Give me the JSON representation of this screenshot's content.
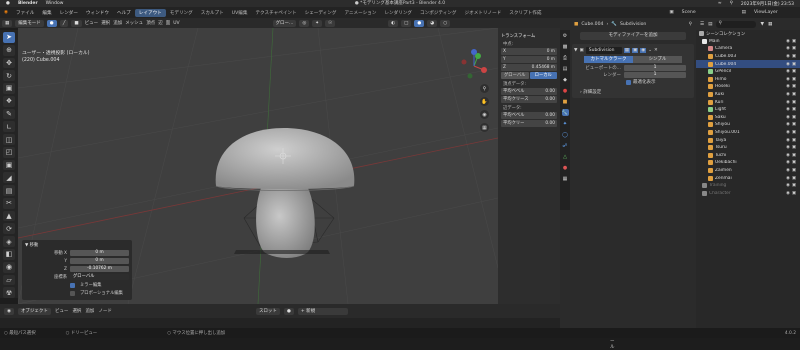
{
  "mac": {
    "app": "Blender",
    "menu": "Window",
    "date": "2023年9月1日(金) 23:53",
    "apple": ""
  },
  "window_title": "● *モデリング基本講座Part3 - Blender 4.0",
  "menubar": {
    "items": [
      "ファイル",
      "編集",
      "レンダー",
      "ウィンドウ",
      "ヘルプ"
    ],
    "workspaces": [
      "レイアウト",
      "モデリング",
      "スカルプト",
      "UV編集",
      "テクスチャペイント",
      "シェーディング",
      "アニメーション",
      "レンダリング",
      "コンポジティング",
      "ジオメトリノード",
      "スクリプト作成"
    ],
    "scene": "Scene",
    "viewlayer": "ViewLayer"
  },
  "viewport_header": {
    "mode": "編集モード",
    "menus": [
      "ビュー",
      "選択",
      "追加",
      "メッシュ",
      "頂点",
      "辺",
      "面",
      "UV"
    ],
    "orientation": "グロー...",
    "options": "オプション"
  },
  "viewport_info": {
    "line1": "ユーザー・透視投影 (ローカル)",
    "line2": "(220) Cube.004"
  },
  "transform": {
    "title": "トランスフォーム",
    "median": "中点:",
    "x": {
      "label": "X",
      "value": "0 m"
    },
    "y": {
      "label": "Y",
      "value": "0 m"
    },
    "z": {
      "label": "Z",
      "value": "0.45468 m"
    },
    "global": "グローバル",
    "local": "ローカル",
    "vertex_data": "頂点データ:",
    "v_bevel": "平均ベベル",
    "v_bevel_val": "0.00",
    "v_crease": "平均クリース",
    "v_crease_val": "0.00",
    "edge_data": "辺データ:",
    "e_bevel": "平均ベベル",
    "e_bevel_val": "0.00",
    "e_crease": "平均クリー",
    "e_crease_val": "0.00"
  },
  "op_panel": {
    "title": "移動",
    "move_x_label": "移動 X",
    "move_x": "0 m",
    "y_label": "Y",
    "y": "0 m",
    "z_label": "Z",
    "z": "-0.10762 m",
    "orient_label": "座標系",
    "orient": "グローバル",
    "mirror": "ミラー編集",
    "proportional": "プロポーショナル編集"
  },
  "timeline": {
    "mode": "オブジェクト",
    "menus": [
      "ビュー",
      "選択",
      "追加",
      "ノード"
    ],
    "slot": "スロット",
    "new": "新規"
  },
  "timeline2": {
    "label": "アクティブツール"
  },
  "status": {
    "left": "最短パス選択",
    "mid": "ドリーピュー",
    "right": "マウス位置に押し出し追加",
    "version": "4.0.2"
  },
  "properties": {
    "breadcrumb_obj": "Cube.004",
    "breadcrumb_mod": "Subdivision",
    "add_modifier": "モディファイアーを追加",
    "mod_name": "Subdivision",
    "catmull": "カトマルクラーク",
    "simple": "シンプル",
    "viewport_label": "ビューポートの...",
    "viewport_val": "1",
    "render_label": "レンダー",
    "render_val": "1",
    "optimal": "最適化表示",
    "advanced": "詳細設定"
  },
  "outliner": {
    "title": "シーンコレクション",
    "rows": [
      {
        "name": "Main",
        "color": "#e8e8e8",
        "sel": false,
        "dim": false
      },
      {
        "name": "Camera",
        "color": "#d88a8a",
        "sel": false,
        "dim": false
      },
      {
        "name": "Cube.003",
        "color": "#e0a040",
        "sel": false,
        "dim": false
      },
      {
        "name": "Cube.004",
        "color": "#e0a040",
        "sel": true,
        "dim": false
      },
      {
        "name": "GPencil",
        "color": "#8ad08a",
        "sel": false,
        "dim": false
      },
      {
        "name": "Himo",
        "color": "#e0a040",
        "sel": false,
        "dim": false
      },
      {
        "name": "Hoseki",
        "color": "#e0a040",
        "sel": false,
        "dim": false
      },
      {
        "name": "Kuki",
        "color": "#e0a040",
        "sel": false,
        "dim": false
      },
      {
        "name": "Kuri",
        "color": "#e0a040",
        "sel": false,
        "dim": false
      },
      {
        "name": "Light",
        "color": "#8ad08a",
        "sel": false,
        "dim": false
      },
      {
        "name": "Saku",
        "color": "#e0a040",
        "sel": false,
        "dim": false
      },
      {
        "name": "Shiyou",
        "color": "#e0a040",
        "sel": false,
        "dim": false
      },
      {
        "name": "Shiyou.001",
        "color": "#e0a040",
        "sel": false,
        "dim": false
      },
      {
        "name": "Taiya",
        "color": "#e0a040",
        "sel": false,
        "dim": false
      },
      {
        "name": "Tsuru",
        "color": "#e0a040",
        "sel": false,
        "dim": false
      },
      {
        "name": "Tuchi",
        "color": "#e0a040",
        "sel": false,
        "dim": false
      },
      {
        "name": "Uekibachi",
        "color": "#e0a040",
        "sel": false,
        "dim": false
      },
      {
        "name": "Zaimen",
        "color": "#e0a040",
        "sel": false,
        "dim": false
      },
      {
        "name": "Zenmai",
        "color": "#e0a040",
        "sel": false,
        "dim": false
      },
      {
        "name": "Training",
        "color": "#888888",
        "sel": false,
        "dim": true
      },
      {
        "name": "Character",
        "color": "#888888",
        "sel": false,
        "dim": true
      }
    ]
  },
  "colors": {
    "accent": "#4772b3",
    "selection": "#334d80",
    "viewport": "#3f3f3f"
  }
}
